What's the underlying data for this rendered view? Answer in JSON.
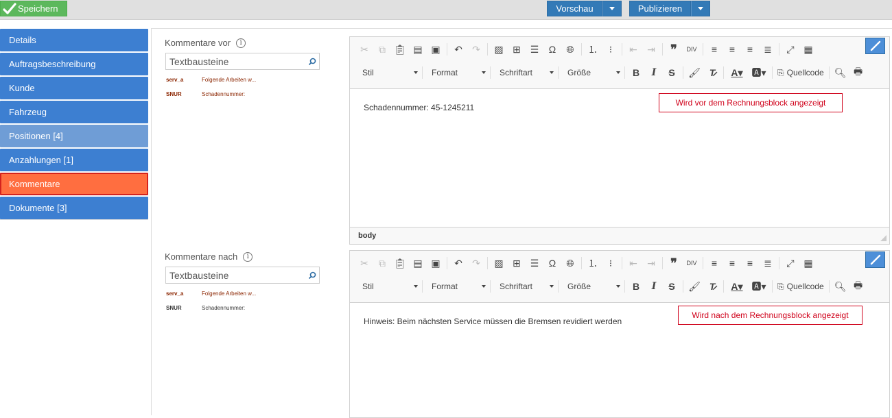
{
  "toolbar": {
    "save_label": "Speichern",
    "preview_label": "Vorschau",
    "publish_label": "Publizieren"
  },
  "sidebar": {
    "items": [
      {
        "label": "Details"
      },
      {
        "label": "Auftragsbeschreibung"
      },
      {
        "label": "Kunde"
      },
      {
        "label": "Fahrzeug"
      },
      {
        "label": "Positionen [4]"
      },
      {
        "label": "Anzahlungen [1]"
      },
      {
        "label": "Kommentare"
      },
      {
        "label": "Dokumente [3]"
      }
    ]
  },
  "comment_before": {
    "label": "Kommentare vor",
    "search_value": "Textbausteine",
    "snippets": [
      {
        "key": "serv_a",
        "text": "Folgende Arbeiten w...",
        "color": "#8b2500"
      },
      {
        "key": "SNUR",
        "text": "Schadennummer:",
        "color": "#8b2500"
      }
    ],
    "content": "Schadennummer: 45-1245211",
    "status": "body",
    "annotation": "Wird vor dem Rechnungsblock angezeigt"
  },
  "comment_after": {
    "label": "Kommentare nach",
    "search_value": "Textbausteine",
    "snippets": [
      {
        "key": "serv_a",
        "text": "Folgende Arbeiten w...",
        "color": "#8b2500"
      },
      {
        "key": "SNUR",
        "text": "Schadennummer:",
        "color": "#333333"
      }
    ],
    "content": "Hinweis: Beim nächsten Service müssen die Bremsen revidiert werden",
    "annotation": "Wird nach dem Rechnungsblock angezeigt"
  },
  "editor_toolbar": {
    "combo_style": "Stil",
    "combo_format": "Format",
    "combo_font": "Schriftart",
    "combo_size": "Größe",
    "source_label": "Quellcode"
  },
  "colors": {
    "nav": "#3d7fd1",
    "nav_active": "#ff6e40",
    "save": "#5cb85c",
    "primary": "#337ab7",
    "annotation": "#d0021b"
  }
}
